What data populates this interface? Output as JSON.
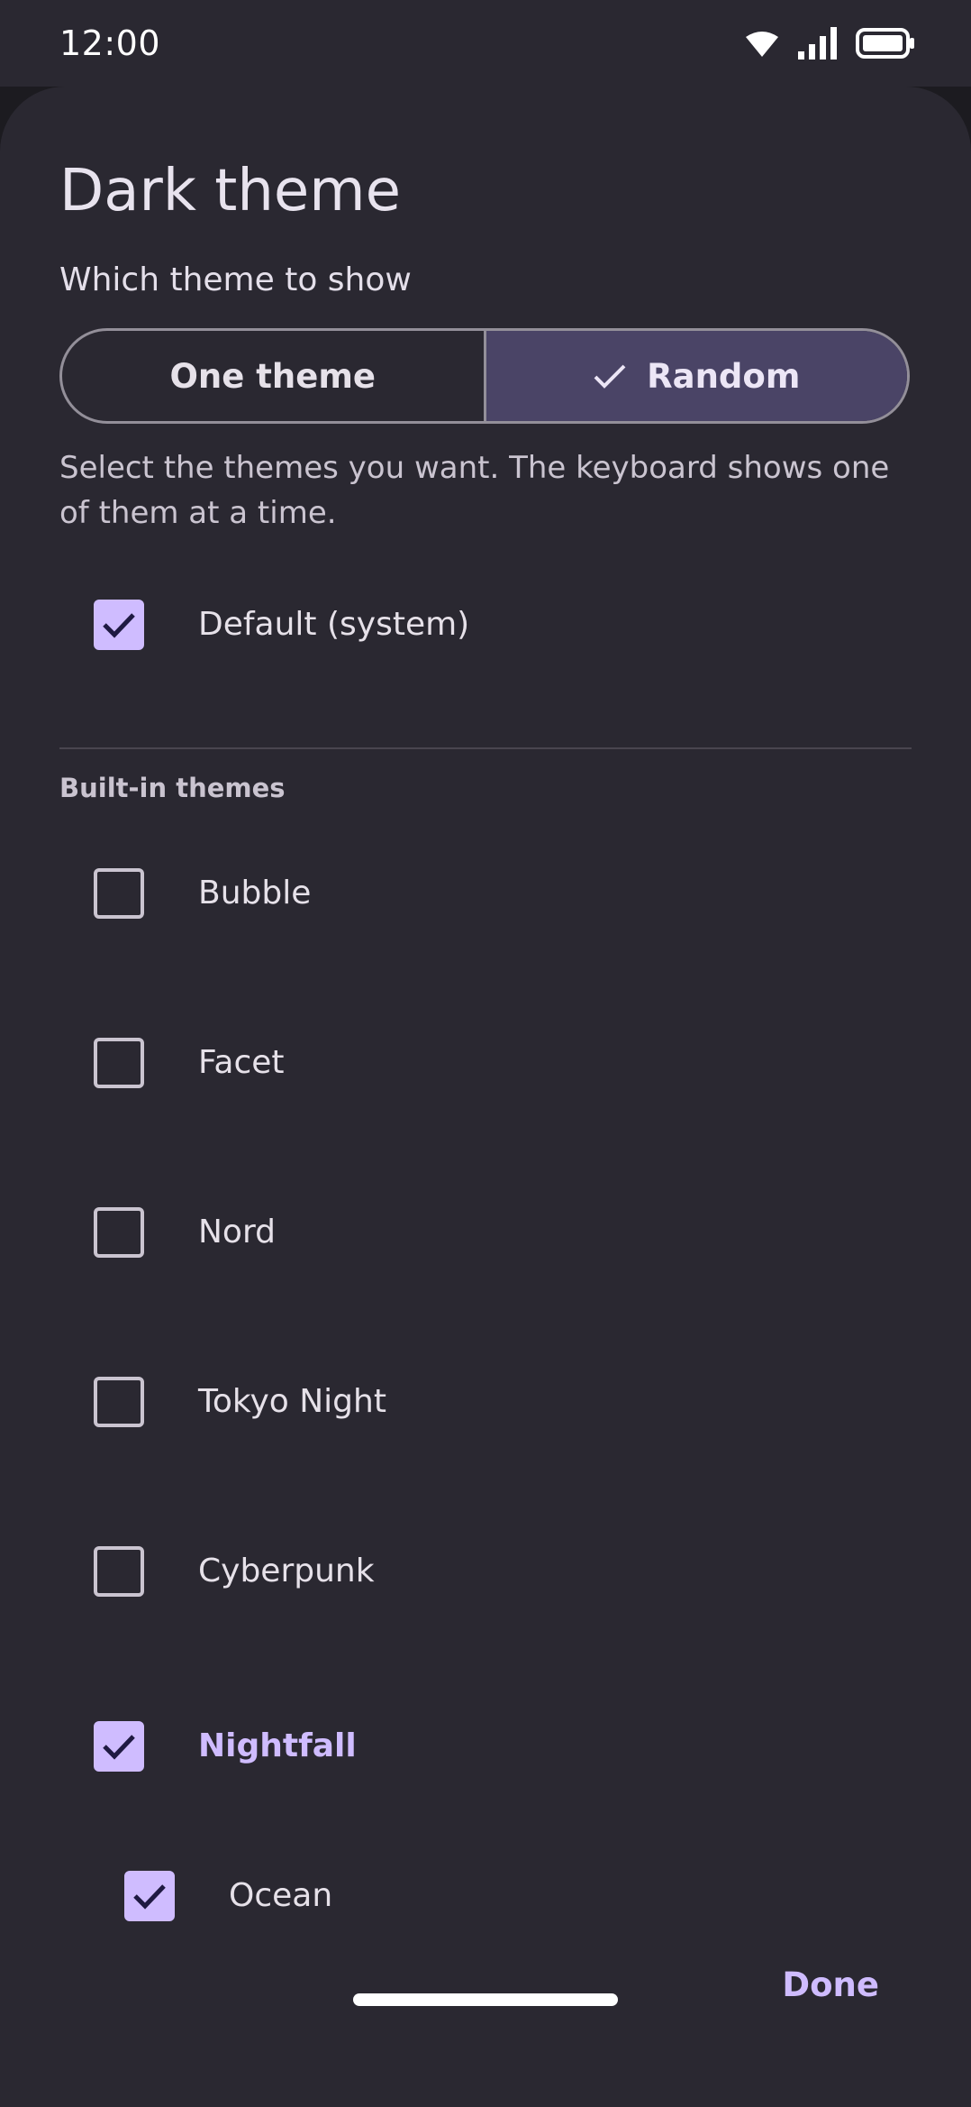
{
  "status_bar": {
    "time": "12:00",
    "icons": [
      "wifi-icon",
      "cell-signal-icon",
      "battery-icon"
    ]
  },
  "sheet": {
    "title": "Dark theme",
    "mode_label": "Which theme to show",
    "mode_options": [
      {
        "label": "One theme",
        "selected": false
      },
      {
        "label": "Random",
        "selected": true
      }
    ],
    "helper_text": "Select the themes you want. The keyboard shows one of them at a time.",
    "default_option": {
      "label": "Default (system)",
      "checked": true
    },
    "group_header": "Built-in themes",
    "themes": [
      {
        "label": "Bubble",
        "checked": false
      },
      {
        "label": "Facet",
        "checked": false
      },
      {
        "label": "Nord",
        "checked": false
      },
      {
        "label": "Tokyo Night",
        "checked": false
      },
      {
        "label": "Cyberpunk",
        "checked": false
      },
      {
        "label": "Nightfall",
        "checked": true
      },
      {
        "label": "Ocean",
        "checked": true
      }
    ],
    "done_label": "Done"
  },
  "colors": {
    "sheet_background": "#2a2831",
    "accent": "#cfbcff",
    "selected_segment": "#4a4466",
    "check_mark": "#1f1a42"
  }
}
